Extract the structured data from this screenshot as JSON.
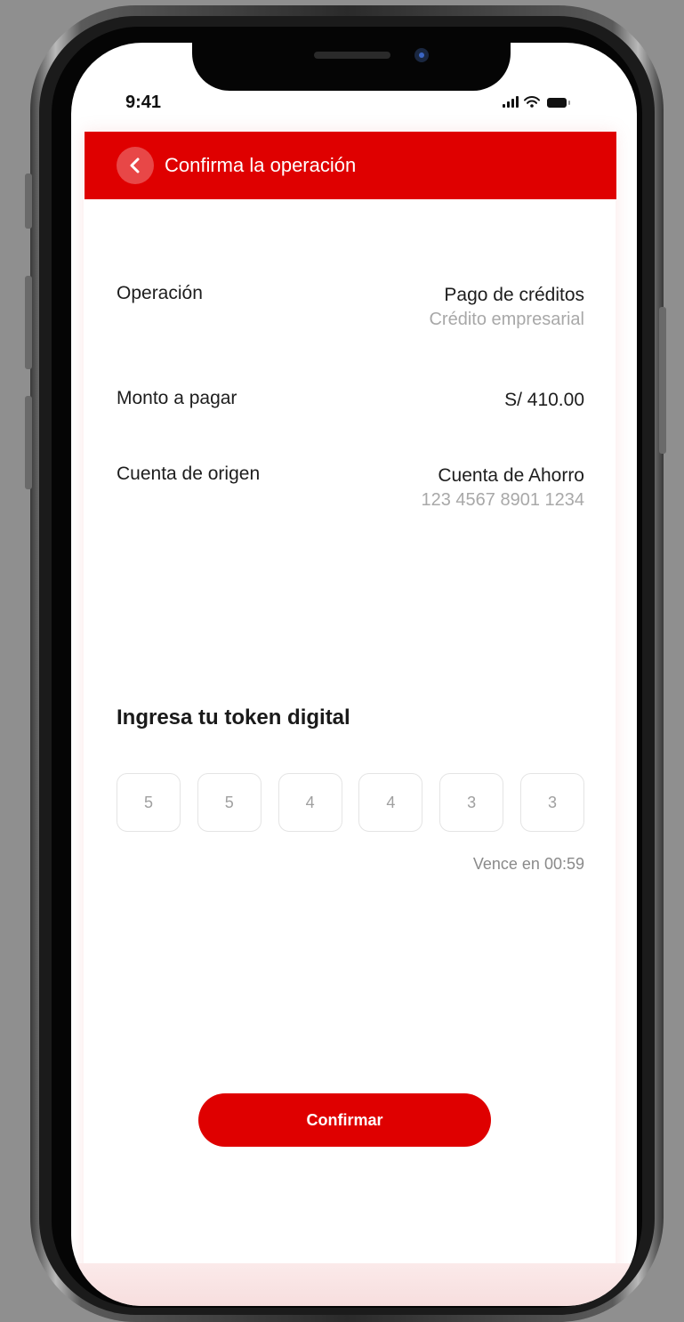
{
  "status_bar": {
    "time": "9:41"
  },
  "header": {
    "title": "Confirma la operación",
    "back_icon": "chevron-left-icon",
    "color": "#df0000"
  },
  "details": [
    {
      "label": "Operación",
      "value": "Pago de créditos",
      "sub": "Crédito empresarial"
    },
    {
      "label": "Monto a pagar",
      "value": "S/ 410.00",
      "sub": ""
    },
    {
      "label": "Cuenta de origen",
      "value": "Cuenta de Ahorro",
      "sub": "123 4567 8901 1234"
    }
  ],
  "token": {
    "title": "Ingresa tu token digital",
    "digits": [
      "5",
      "5",
      "4",
      "4",
      "3",
      "3"
    ],
    "expiry": "Vence en 00:59"
  },
  "actions": {
    "confirm_label": "Confirmar"
  },
  "colors": {
    "accent": "#df0000",
    "frame": "#8f8f8f"
  }
}
